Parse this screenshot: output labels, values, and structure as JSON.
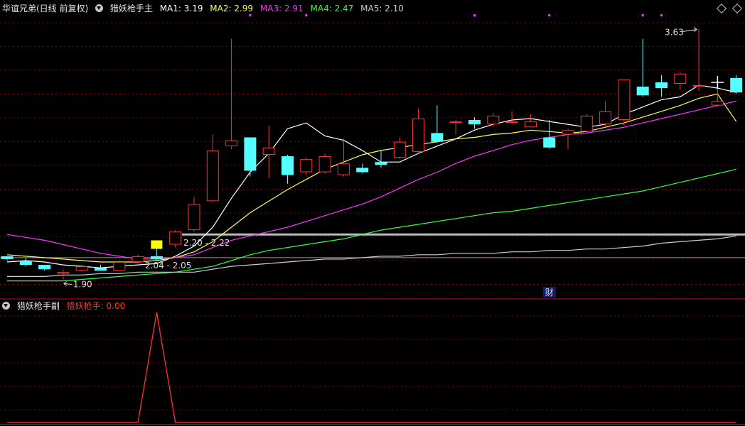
{
  "header": {
    "stock": "华谊兄弟(日线 前复权)",
    "indicator": "猎妖枪手主",
    "ma": [
      {
        "label": "MA1: 3.19",
        "color": "#ffffff"
      },
      {
        "label": "MA2: 2.99",
        "color": "#ffff55"
      },
      {
        "label": "MA3: 2.91",
        "color": "#ff33ff"
      },
      {
        "label": "MA4: 2.47",
        "color": "#33ff33"
      },
      {
        "label": "MA5: 2.10",
        "color": "#cccccc"
      }
    ]
  },
  "sub_header": {
    "indicator": "猎妖枪手副",
    "value_label": "猎妖枪手: 0.00",
    "value_color": "#ff3333"
  },
  "annotations": {
    "high": "3.63",
    "low": "1.90",
    "range_upper": "2.20 - 2.22",
    "range_lower": "2.04 - 2.05",
    "finance_marker": "财"
  },
  "colors": {
    "up": "#ff3333",
    "down": "#54ffff",
    "grid": "#8b0000",
    "signal": "#ffff00"
  },
  "chart_data": [
    {
      "type": "candlestick",
      "ylim": [
        1.78,
        3.74
      ],
      "x": [
        1,
        2,
        3,
        4,
        5,
        6,
        7,
        8,
        9,
        10,
        11,
        12,
        13,
        14,
        15,
        16,
        17,
        18,
        19,
        20,
        21,
        22,
        23,
        24,
        25,
        26,
        27,
        28,
        29,
        30,
        31,
        32,
        33,
        34,
        35,
        36,
        37,
        38,
        39,
        40
      ],
      "open": [
        2.06,
        2.03,
        2.0,
        1.95,
        1.96,
        1.98,
        1.96,
        2.02,
        2.06,
        2.14,
        2.24,
        2.44,
        2.82,
        2.88,
        2.76,
        2.75,
        2.64,
        2.64,
        2.62,
        2.67,
        2.71,
        2.74,
        2.78,
        2.91,
        2.98,
        3.0,
        2.97,
        2.98,
        2.95,
        2.88,
        2.9,
        2.92,
        2.97,
        3.0,
        3.23,
        3.26,
        3.25,
        3.23,
        3.1,
        3.29
      ],
      "close": [
        2.04,
        2.0,
        1.97,
        1.95,
        1.99,
        1.96,
        2.02,
        2.06,
        2.04,
        2.23,
        2.42,
        2.79,
        2.86,
        2.65,
        2.81,
        2.62,
        2.73,
        2.75,
        2.7,
        2.64,
        2.69,
        2.85,
        3.01,
        2.85,
        2.99,
        2.97,
        3.03,
        2.99,
        2.99,
        2.81,
        2.93,
        3.03,
        3.06,
        3.28,
        3.17,
        3.22,
        3.32,
        3.24,
        3.13,
        3.19
      ],
      "high": [
        2.06,
        2.05,
        2.0,
        1.97,
        2.0,
        2.0,
        2.03,
        2.07,
        2.11,
        2.24,
        2.47,
        2.9,
        3.56,
        2.88,
        2.96,
        2.76,
        2.74,
        2.77,
        2.87,
        2.7,
        2.79,
        2.88,
        3.08,
        3.1,
        3.0,
        3.02,
        3.05,
        3.06,
        3.04,
        3.0,
        2.94,
        3.04,
        3.13,
        3.25,
        3.56,
        3.31,
        3.33,
        3.63,
        3.29,
        3.31
      ],
      "low": [
        2.03,
        1.99,
        1.96,
        1.9,
        1.95,
        1.96,
        1.96,
        2.01,
        2.03,
        2.12,
        2.23,
        2.43,
        2.8,
        2.61,
        2.6,
        2.56,
        2.62,
        2.63,
        2.61,
        2.63,
        2.67,
        2.73,
        2.77,
        2.84,
        2.9,
        2.94,
        2.95,
        2.97,
        2.96,
        2.8,
        2.8,
        2.91,
        2.95,
        2.96,
        3.16,
        3.16,
        3.21,
        3.2,
        3.1,
        3.18
      ],
      "series": [
        {
          "name": "MA1",
          "color": "#ffffff",
          "values": [
            2.02,
            2.03,
            2.02,
            2.0,
            1.99,
            1.98,
            1.99,
            2.0,
            2.01,
            2.06,
            2.13,
            2.26,
            2.46,
            2.64,
            2.77,
            2.94,
            2.98,
            2.89,
            2.86,
            2.79,
            2.71,
            2.71,
            2.77,
            2.82,
            2.87,
            2.93,
            2.97,
            3.0,
            3.01,
            2.99,
            2.97,
            2.95,
            2.97,
            3.04,
            3.09,
            3.14,
            3.16,
            3.24,
            3.22,
            3.19
          ]
        },
        {
          "name": "MA2",
          "color": "#ffff55",
          "values": [
            2.07,
            2.06,
            2.05,
            2.04,
            2.03,
            2.02,
            2.02,
            2.02,
            2.03,
            2.05,
            2.09,
            2.16,
            2.26,
            2.36,
            2.44,
            2.52,
            2.59,
            2.66,
            2.71,
            2.76,
            2.79,
            2.81,
            2.83,
            2.85,
            2.87,
            2.88,
            2.9,
            2.91,
            2.93,
            2.92,
            2.91,
            2.92,
            2.95,
            2.98,
            3.02,
            3.06,
            3.1,
            3.15,
            3.18,
            2.99
          ]
        },
        {
          "name": "MA3",
          "color": "#ff33ff",
          "values": [
            2.21,
            2.19,
            2.17,
            2.14,
            2.11,
            2.08,
            2.06,
            2.04,
            2.04,
            2.05,
            2.07,
            2.12,
            2.17,
            2.2,
            2.23,
            2.26,
            2.3,
            2.34,
            2.38,
            2.42,
            2.47,
            2.53,
            2.59,
            2.64,
            2.7,
            2.75,
            2.79,
            2.83,
            2.86,
            2.88,
            2.9,
            2.91,
            2.93,
            2.95,
            2.98,
            3.01,
            3.04,
            3.07,
            3.1,
            3.13
          ]
        },
        {
          "name": "MA4",
          "color": "#33ff33",
          "values": [
            1.89,
            1.89,
            1.89,
            1.89,
            1.9,
            1.91,
            1.92,
            1.93,
            1.94,
            1.95,
            1.97,
            1.99,
            2.03,
            2.07,
            2.1,
            2.12,
            2.14,
            2.16,
            2.18,
            2.21,
            2.24,
            2.26,
            2.28,
            2.3,
            2.32,
            2.34,
            2.36,
            2.37,
            2.39,
            2.41,
            2.43,
            2.45,
            2.47,
            2.49,
            2.51,
            2.54,
            2.57,
            2.6,
            2.63,
            2.66
          ]
        },
        {
          "name": "MA5",
          "color": "#cccccc",
          "values": [
            1.92,
            1.92,
            1.92,
            1.93,
            1.93,
            1.94,
            1.94,
            1.95,
            1.95,
            1.95,
            1.95,
            1.97,
            1.99,
            2.0,
            2.01,
            2.02,
            2.03,
            2.04,
            2.04,
            2.05,
            2.06,
            2.06,
            2.07,
            2.07,
            2.08,
            2.08,
            2.08,
            2.09,
            2.09,
            2.1,
            2.1,
            2.11,
            2.11,
            2.12,
            2.13,
            2.15,
            2.16,
            2.17,
            2.18,
            2.2
          ]
        }
      ],
      "hlines": [
        {
          "y": 2.21,
          "color": "#bbbbbb"
        },
        {
          "y": 2.05,
          "color": "#999999"
        }
      ]
    },
    {
      "type": "line",
      "ylim": [
        0,
        1
      ],
      "x": [
        1,
        2,
        3,
        4,
        5,
        6,
        7,
        8,
        9,
        10,
        11,
        12,
        13,
        14,
        15,
        16,
        17,
        18,
        19,
        20,
        21,
        22,
        23,
        24,
        25,
        26,
        27,
        28,
        29,
        30,
        31,
        32,
        33,
        34,
        35,
        36,
        37,
        38,
        39,
        40
      ],
      "series": [
        {
          "name": "猎妖枪手",
          "color": "#ff3333",
          "values": [
            0,
            0,
            0,
            0,
            0,
            0,
            0,
            0,
            1,
            0,
            0,
            0,
            0,
            0,
            0,
            0,
            0,
            0,
            0,
            0,
            0,
            0,
            0,
            0,
            0,
            0,
            0,
            0,
            0,
            0,
            0,
            0,
            0,
            0,
            0,
            0,
            0,
            0,
            0,
            0
          ]
        }
      ]
    }
  ]
}
